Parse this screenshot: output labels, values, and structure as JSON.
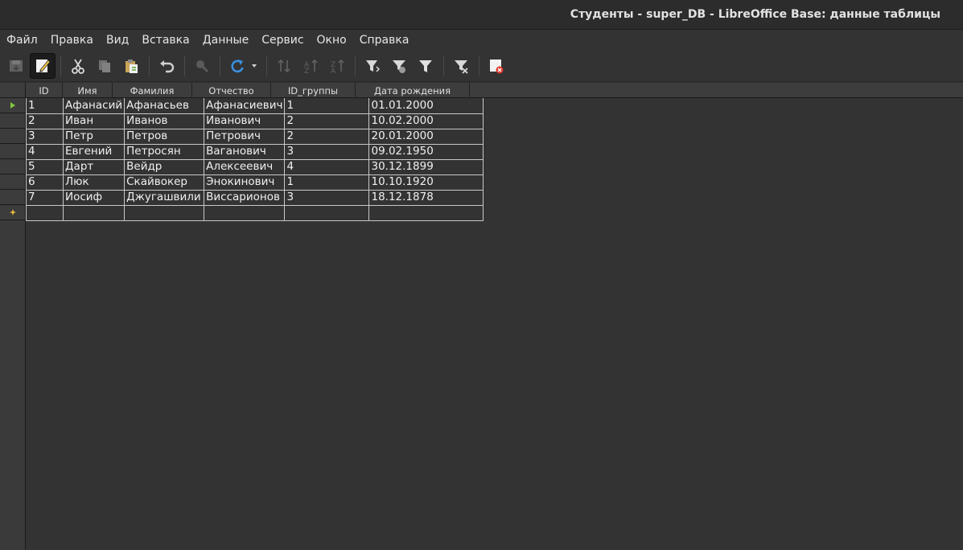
{
  "window": {
    "title": "Студенты - super_DB - LibreOffice Base: данные таблицы"
  },
  "menu": [
    "Файл",
    "Правка",
    "Вид",
    "Вставка",
    "Данные",
    "Сервис",
    "Окно",
    "Справка"
  ],
  "toolbar": {
    "icons": [
      "save-record-icon",
      "edit-data-icon",
      "cut-icon",
      "copy-icon",
      "paste-icon",
      "undo-icon",
      "find-record-icon",
      "refresh-icon",
      "sort-icon",
      "sort-ascending-icon",
      "sort-descending-icon",
      "autofilter-icon",
      "apply-filter-icon",
      "standard-filter-icon",
      "reset-filter-icon",
      "delete-record-icon"
    ]
  },
  "table": {
    "columns": [
      "ID",
      "Имя",
      "Фамилия",
      "Отчество",
      "ID_группы",
      "Дата рождения"
    ],
    "rows": [
      [
        "1",
        "Афанасий",
        "Афанасьев",
        "Афанасиевич",
        "1",
        "01.01.2000"
      ],
      [
        "2",
        "Иван",
        "Иванов",
        "Иванович",
        "2",
        "10.02.2000"
      ],
      [
        "3",
        "Петр",
        "Петров",
        "Петрович",
        "2",
        "20.01.2000"
      ],
      [
        "4",
        "Евгений",
        "Петросян",
        "Ваганович",
        "3",
        "09.02.1950"
      ],
      [
        "5",
        "Дарт",
        "Вейдр",
        "Алексеевич",
        "4",
        "30.12.1899"
      ],
      [
        "6",
        "Люк",
        "Скайвокер",
        "Энокинович",
        "1",
        "10.10.1920"
      ],
      [
        "7",
        "Иосиф",
        "Джугашвили",
        "Виссарионов",
        "3",
        "18.12.1878"
      ]
    ],
    "new_row": [
      "",
      "",
      "",
      "",
      "",
      ""
    ]
  },
  "colors": {
    "background": "#333333",
    "grid_lines": "#c8c8c8",
    "current_row_marker": "#7ec63a",
    "new_row_marker": "#f0c040"
  }
}
